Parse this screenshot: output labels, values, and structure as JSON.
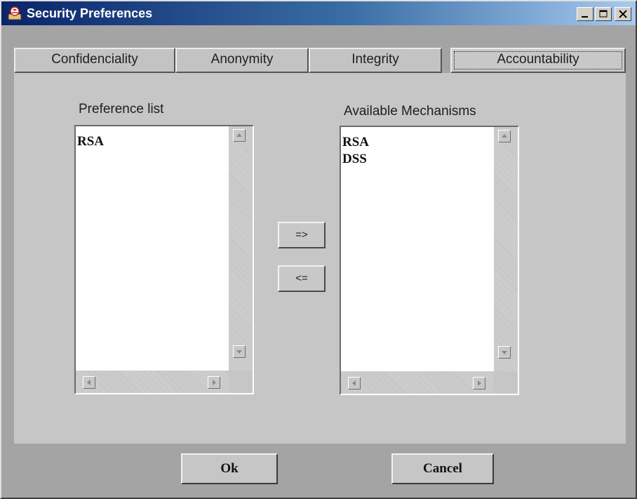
{
  "window": {
    "title": "Security Preferences",
    "accent_gradient": [
      "#0a246a",
      "#a6caf0"
    ]
  },
  "window_controls": {
    "minimize_icon": "minimize-icon",
    "maximize_icon": "maximize-icon",
    "close_icon": "close-icon"
  },
  "tabs": [
    {
      "label": "Confidenciality",
      "selected": false
    },
    {
      "label": "Anonymity",
      "selected": false
    },
    {
      "label": "Integrity",
      "selected": false
    },
    {
      "label": "Accountability",
      "selected": true
    }
  ],
  "preference_list": {
    "label": "Preference list",
    "items": [
      "RSA"
    ]
  },
  "available_mechanisms": {
    "label": "Available Mechanisms",
    "items": [
      "RSA",
      "DSS"
    ]
  },
  "transfer_buttons": {
    "add_label": "=>",
    "remove_label": "<="
  },
  "dialog_buttons": {
    "ok_label": "Ok",
    "cancel_label": "Cancel"
  }
}
